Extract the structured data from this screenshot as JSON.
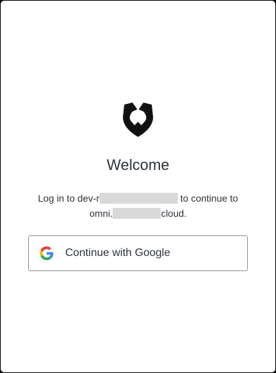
{
  "heading": "Welcome",
  "description": {
    "prefix": "Log in to dev-r",
    "middle": " to continue to",
    "line2_prefix": "omni.",
    "line2_suffix": "cloud."
  },
  "google_button": {
    "label": "Continue with Google",
    "icon": "google-logo-icon"
  },
  "logo": {
    "icon": "shield-logo-icon",
    "color": "#111111"
  },
  "colors": {
    "background": "#000000",
    "card": "#ffffff",
    "text": "#2d333a",
    "redaction": "#d9d9d9"
  }
}
